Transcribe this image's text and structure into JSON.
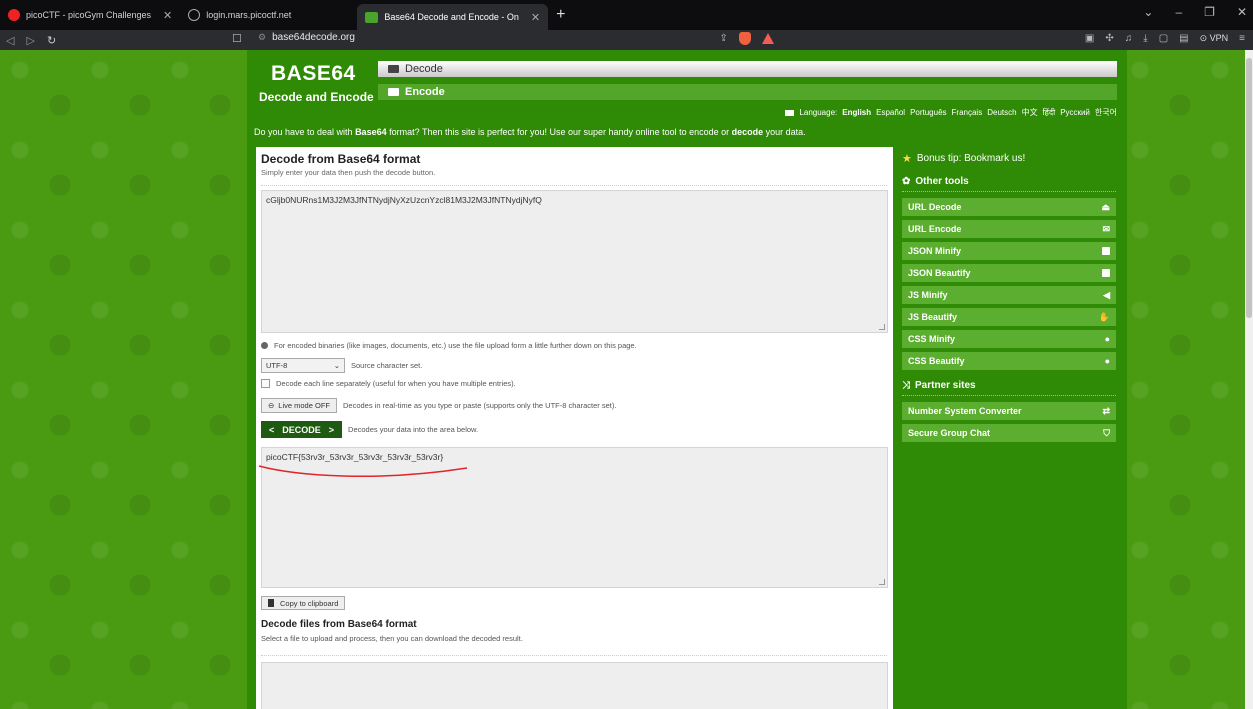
{
  "browser": {
    "tabs": [
      {
        "title": "picoCTF - picoGym Challenges",
        "active": false
      },
      {
        "title": "login.mars.picoctf.net",
        "active": false
      },
      {
        "title": "Base64 Decode and Encode - On",
        "active": true
      }
    ],
    "new_tab": "+",
    "url": "base64decode.org",
    "vpn_label": "VPN"
  },
  "header": {
    "logo_title": "BASE64",
    "logo_subtitle": "Decode and Encode",
    "menu_decode": "Decode",
    "menu_encode": "Encode",
    "language_label": "Language:",
    "languages": [
      "English",
      "Español",
      "Português",
      "Français",
      "Deutsch",
      "中文",
      "हिंदी",
      "Русский",
      "한국어"
    ],
    "tagline_pre": "Do you have to deal with ",
    "tagline_b1": "Base64",
    "tagline_mid": " format? Then this site is perfect for you! Use our super handy online tool to encode or ",
    "tagline_b2": "decode",
    "tagline_post": " your data."
  },
  "decode_section": {
    "title": "Decode from Base64 format",
    "subtitle": "Simply enter your data then push the decode button.",
    "input_value": "cGljb0NURns1M3J2M3JfNTNydjNyXzUzcnYzcl81M3J2M3JfNTNydjNyfQ",
    "binary_note": "For encoded binaries (like images, documents, etc.) use the file upload form a little further down on this page.",
    "charset_value": "UTF-8",
    "charset_label": "Source character set.",
    "each_line_label": "Decode each line separately (useful for when you have multiple entries).",
    "live_button": "Live mode OFF",
    "live_desc": "Decodes in real-time as you type or paste (supports only the UTF-8 character set).",
    "decode_button": "DECODE",
    "decode_desc": "Decodes your data into the area below.",
    "output_value": "picoCTF{53rv3r_53rv3r_53rv3r_53rv3r_53rv3r}",
    "copy_button": "Copy to clipboard"
  },
  "file_section": {
    "title": "Decode files from Base64 format",
    "subtitle": "Select a file to upload and process, then you can download the decoded result."
  },
  "sidebar": {
    "bonus_tip": "Bonus tip: Bookmark us!",
    "other_tools_title": "Other tools",
    "tools": [
      "URL Decode",
      "URL Encode",
      "JSON Minify",
      "JSON Beautify",
      "JS Minify",
      "JS Beautify",
      "CSS Minify",
      "CSS Beautify"
    ],
    "partner_title": "Partner sites",
    "partners": [
      "Number System Converter",
      "Secure Group Chat"
    ]
  },
  "colors": {
    "page_green": "#4a9a12",
    "main_green": "#2f8a06",
    "tool_green": "#5bae30",
    "decode_btn": "#1f5a12",
    "annotation_red": "#e0262b"
  }
}
